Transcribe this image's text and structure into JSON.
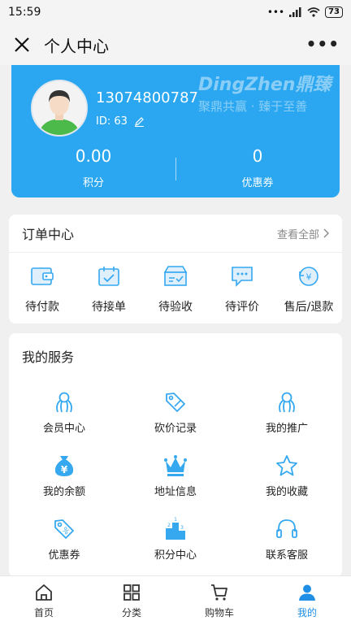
{
  "status": {
    "time": "15:59",
    "battery": "73"
  },
  "header": {
    "title": "个人中心"
  },
  "profile": {
    "phone": "13074800787",
    "id_text": "ID: 63",
    "watermark_brand": "DingZhen鼎臻",
    "watermark_slogan": "聚鼎共赢 · 臻于至善",
    "points_value": "0.00",
    "points_label": "积分",
    "coupons_value": "0",
    "coupons_label": "优惠券"
  },
  "orders": {
    "title": "订单中心",
    "view_all": "查看全部",
    "items": [
      {
        "label": "待付款",
        "icon": "wallet-icon"
      },
      {
        "label": "待接单",
        "icon": "calendar-check-icon"
      },
      {
        "label": "待验收",
        "icon": "box-check-icon"
      },
      {
        "label": "待评价",
        "icon": "chat-bubble-icon"
      },
      {
        "label": "售后/退款",
        "icon": "refund-icon"
      }
    ]
  },
  "services": {
    "title": "我的服务",
    "items": [
      {
        "label": "会员中心",
        "icon": "member-icon"
      },
      {
        "label": "砍价记录",
        "icon": "price-tag-icon"
      },
      {
        "label": "我的推广",
        "icon": "promotion-icon"
      },
      {
        "label": "我的余额",
        "icon": "money-bag-icon"
      },
      {
        "label": "地址信息",
        "icon": "crown-icon"
      },
      {
        "label": "我的收藏",
        "icon": "star-icon"
      },
      {
        "label": "优惠券",
        "icon": "coupon-icon"
      },
      {
        "label": "积分中心",
        "icon": "podium-icon"
      },
      {
        "label": "联系客服",
        "icon": "headset-icon"
      }
    ]
  },
  "tabbar": {
    "items": [
      {
        "label": "首页",
        "icon": "home-icon"
      },
      {
        "label": "分类",
        "icon": "grid-icon"
      },
      {
        "label": "购物车",
        "icon": "cart-icon"
      },
      {
        "label": "我的",
        "icon": "user-icon"
      }
    ],
    "active": "我的"
  },
  "colors": {
    "accent": "#2aa7f0",
    "icon_blue": "#35a8f0",
    "tab_active": "#1f8fe6"
  }
}
